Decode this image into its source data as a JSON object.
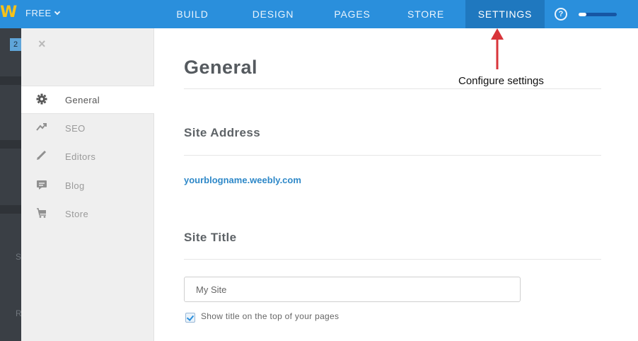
{
  "topbar": {
    "logo": "W",
    "plan_label": "FREE",
    "tabs": [
      {
        "label": "BUILD"
      },
      {
        "label": "DESIGN"
      },
      {
        "label": "PAGES"
      },
      {
        "label": "STORE"
      },
      {
        "label": "SETTINGS",
        "active": true
      }
    ],
    "help_glyph": "?",
    "progress_percent": 20
  },
  "left_strip": {
    "badge": "2",
    "letters": [
      "S",
      "R"
    ]
  },
  "sidebar": {
    "close_glyph": "×",
    "items": [
      {
        "label": "General",
        "icon": "gear-icon",
        "active": true
      },
      {
        "label": "SEO",
        "icon": "trend-icon"
      },
      {
        "label": "Editors",
        "icon": "pencil-icon"
      },
      {
        "label": "Blog",
        "icon": "comment-icon"
      },
      {
        "label": "Store",
        "icon": "cart-icon"
      }
    ]
  },
  "main": {
    "title": "General",
    "site_address": {
      "heading": "Site Address",
      "value": "yourblogname.weebly.com"
    },
    "site_title": {
      "heading": "Site Title",
      "input_value": "My Site",
      "checkbox_label": "Show title on the top of your pages",
      "checkbox_checked": true
    }
  },
  "annotation": {
    "text": "Configure settings",
    "arrow_color": "#d8343a"
  },
  "colors": {
    "topbar": "#2a8fdc",
    "active_tab": "#1f78bf",
    "link": "#2e88c8"
  }
}
